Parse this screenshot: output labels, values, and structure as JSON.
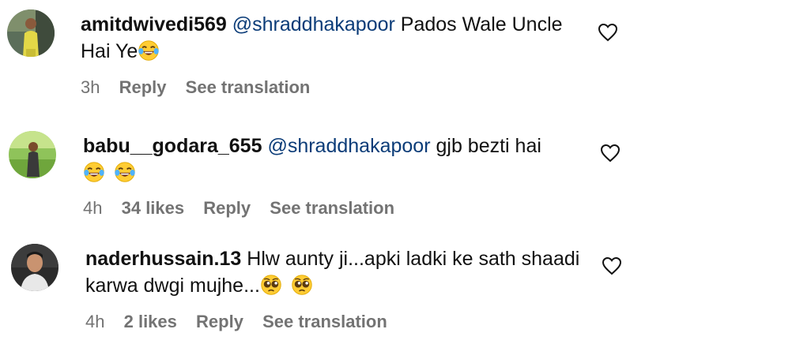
{
  "comments": [
    {
      "username": "amitdwivedi569",
      "mention": "@shraddhakapoor",
      "text_line1": "Pados Wale Uncle",
      "text_line2": "Hai Ye",
      "emojis": [
        "laughing-tears-emoji"
      ],
      "time": "3h",
      "likes": "",
      "reply_label": "Reply",
      "translate_label": "See translation"
    },
    {
      "username": "babu__godara_655",
      "mention": "@shraddhakapoor",
      "text_line1": "gjb bezti hai",
      "text_line2": "",
      "emojis": [
        "laughing-tears-emoji",
        "laughing-tears-emoji"
      ],
      "time": "4h",
      "likes": "34 likes",
      "reply_label": "Reply",
      "translate_label": "See translation"
    },
    {
      "username": "naderhussain.13",
      "mention": "",
      "text_line1": "Hlw aunty ji...apki ladki ke sath shaadi",
      "text_line2": "karwa dwgi mujhe...",
      "emojis": [
        "pleading-face-emoji",
        "pleading-face-emoji"
      ],
      "time": "4h",
      "likes": "2 likes",
      "reply_label": "Reply",
      "translate_label": "See translation"
    }
  ],
  "colors": {
    "text": "#111111",
    "mention": "#0b3c78",
    "meta": "#737373"
  },
  "icons": {
    "like": "heart-outline-icon"
  }
}
